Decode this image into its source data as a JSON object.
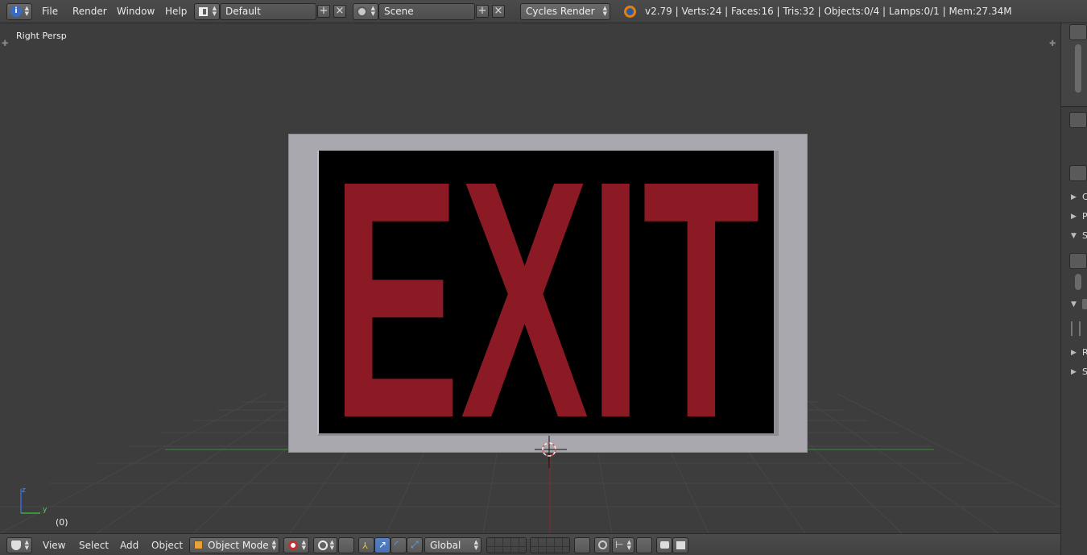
{
  "top_menu": {
    "info_icon": "info-icon",
    "items": [
      "File",
      "Render",
      "Window",
      "Help"
    ],
    "layout": {
      "icon": "screen-layout-icon",
      "value": "Default"
    },
    "scene": {
      "icon": "scene-icon",
      "value": "Scene"
    },
    "engine": {
      "value": "Cycles Render"
    },
    "blender_icon": "blender-logo-icon",
    "status": "v2.79 | Verts:24 | Faces:16 | Tris:32 | Objects:0/4 | Lamps:0/1 | Mem:27.34M"
  },
  "viewport": {
    "view_label": "Right Persp",
    "frame_label": "(0)",
    "sign_text": "EXIT",
    "sign_text_color": "#8b1a24",
    "axis_z": "z",
    "axis_y": "y"
  },
  "right_panel": {
    "rows": [
      "C",
      "P",
      "S",
      "R",
      "S"
    ]
  },
  "bottom_menu": {
    "items": [
      "View",
      "Select",
      "Add",
      "Object"
    ],
    "mode": "Object Mode",
    "orientation": "Global"
  },
  "colors": {
    "background": "#3d3d3d",
    "header": "#454545",
    "accent": "#5680c2",
    "grid_green": "#3a8a3a",
    "axis_red": "#b03030"
  }
}
